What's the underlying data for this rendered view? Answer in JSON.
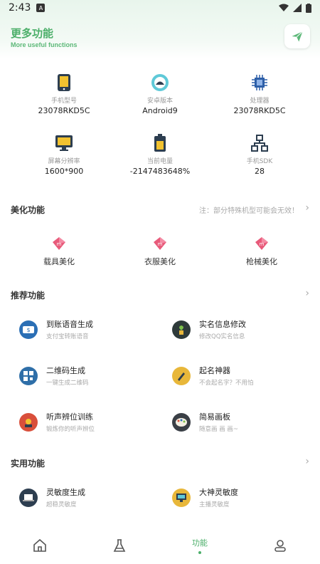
{
  "status_bar": {
    "time": "2:43",
    "notif": "A"
  },
  "header": {
    "title": "更多功能",
    "subtitle": "More useful functions",
    "action_icon": "send-icon"
  },
  "device_info": [
    {
      "label": "手机型号",
      "value": "23078RKD5C",
      "icon": "phone-icon"
    },
    {
      "label": "安卓版本",
      "value": "Android9",
      "icon": "android-icon"
    },
    {
      "label": "处理器",
      "value": "23078RKD5C",
      "icon": "chip-icon"
    },
    {
      "label": "屏幕分辨率",
      "value": "1600*900",
      "icon": "monitor-icon"
    },
    {
      "label": "当前电量",
      "value": "-2147483648%",
      "icon": "battery-icon"
    },
    {
      "label": "手机SDK",
      "value": "28",
      "icon": "network-icon"
    }
  ],
  "beautify": {
    "title": "美化功能",
    "note": "注：部分特殊机型可能会无效！",
    "items": [
      {
        "label": "载具美化",
        "icon": "vehicle-skin-icon"
      },
      {
        "label": "衣服美化",
        "icon": "clothes-skin-icon"
      },
      {
        "label": "枪械美化",
        "icon": "weapon-skin-icon"
      }
    ]
  },
  "recommend": {
    "title": "推荐功能",
    "items": [
      {
        "title": "到账语音生成",
        "desc": "支付宝转账语音",
        "icon": "payment-voice-icon",
        "color": "#2b6fb5"
      },
      {
        "title": "实名信息修改",
        "desc": "修改QQ实名信息",
        "icon": "plant-icon",
        "color": "#2e3a3a"
      },
      {
        "title": "二维码生成",
        "desc": "一键生成二维码",
        "icon": "qrcode-icon",
        "color": "#2f6fa8"
      },
      {
        "title": "起名神器",
        "desc": "不会起名字？不用怕",
        "icon": "pen-icon",
        "color": "#e8b73a"
      },
      {
        "title": "听声辨位训练",
        "desc": "锻炼你的听声辨位",
        "icon": "headset-icon",
        "color": "#d94f3b"
      },
      {
        "title": "简易画板",
        "desc": "随意画 画 画~",
        "icon": "palette-icon",
        "color": "#3a3f46"
      }
    ]
  },
  "utility": {
    "title": "实用功能",
    "items": [
      {
        "title": "灵敏度生成",
        "desc": "超稳灵敏度",
        "icon": "laptop-icon",
        "color": "#2d3e50"
      },
      {
        "title": "大神灵敏度",
        "desc": "主播灵敏度",
        "icon": "computer-icon",
        "color": "#e8b73a"
      }
    ]
  },
  "bottom_nav": {
    "active_label": "功能"
  },
  "colors": {
    "accent": "#4caf6a"
  }
}
